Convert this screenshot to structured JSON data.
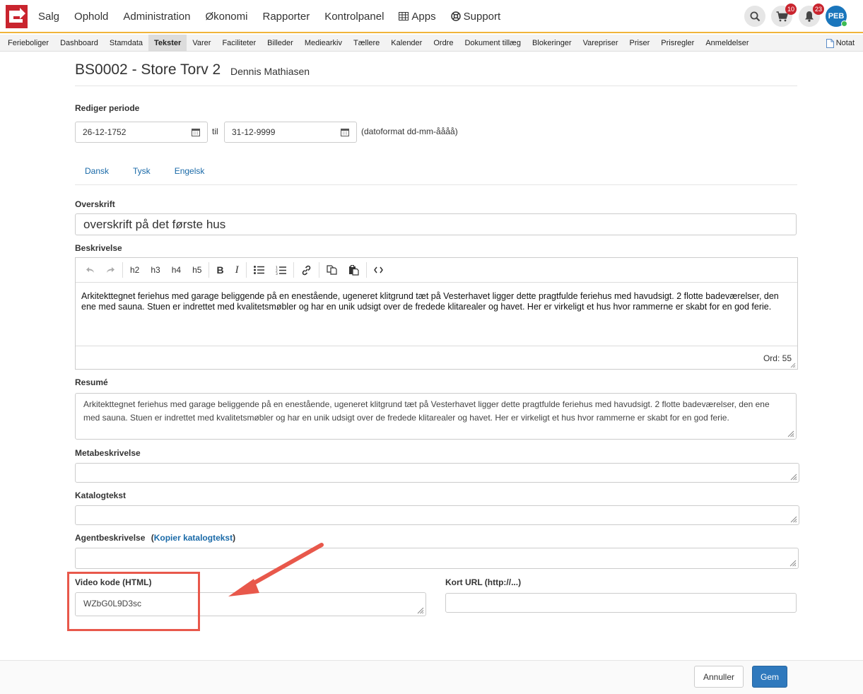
{
  "nav": {
    "items": [
      "Salg",
      "Ophold",
      "Administration",
      "Økonomi",
      "Rapporter",
      "Kontrolpanel",
      "Apps",
      "Support"
    ],
    "cart_count": "10",
    "notification_count": "23",
    "user_initials": "PEB"
  },
  "subnav": {
    "items": [
      "Ferieboliger",
      "Dashboard",
      "Stamdata",
      "Tekster",
      "Varer",
      "Faciliteter",
      "Billeder",
      "Mediearkiv",
      "Tællere",
      "Kalender",
      "Ordre",
      "Dokument tillæg",
      "Blokeringer",
      "Varepriser",
      "Priser",
      "Prisregler",
      "Anmeldelser"
    ],
    "active": "Tekster",
    "note_label": "Notat"
  },
  "header": {
    "title": "BS0002 - Store Torv 2",
    "owner": "Dennis Mathiasen"
  },
  "period": {
    "label": "Rediger periode",
    "from": "26-12-1752",
    "to_word": "til",
    "to": "31-12-9999",
    "format_hint": "(datoformat dd-mm-åååå)"
  },
  "language_tabs": [
    "Dansk",
    "Tysk",
    "Engelsk"
  ],
  "fields": {
    "headline_label": "Overskrift",
    "headline_value": "overskrift på det første hus",
    "description_label": "Beskrivelse",
    "description_text": "Arkitekttegnet feriehus med garage beliggende på en enestående, ugeneret klitgrund tæt på Vesterhavet ligger dette pragtfulde feriehus med havudsigt. 2 flotte badeværelser, den ene med sauna. Stuen er indrettet med kvalitetsmøbler og har en unik udsigt over de fredede klitarealer og havet. Her er virkeligt et hus hvor rammerne er skabt for en god ferie.",
    "word_count": "Ord: 55",
    "summary_label": "Resumé",
    "summary_text": "Arkitekttegnet feriehus med garage beliggende på en enestående, ugeneret klitgrund tæt på Vesterhavet ligger dette pragtfulde feriehus med havudsigt. 2 flotte badeværelser, den ene med  sauna. Stuen er indrettet med kvalitetsmøbler og har en unik udsigt over de fredede klitarealer og havet. Her er virkeligt et hus hvor rammerne er skabt for en god ferie.",
    "meta_label": "Metabeskrivelse",
    "catalog_label": "Katalogtekst",
    "agent_label": "Agentbeskrivelse",
    "agent_paren_open": "(",
    "agent_link": "Kopier katalogtekst",
    "agent_paren_close": ")",
    "video_label": "Video kode (HTML)",
    "video_value": "WZbG0L9D3sc",
    "short_url_label": "Kort URL (http://...)"
  },
  "toolbar": {
    "h2": "h2",
    "h3": "h3",
    "h4": "h4",
    "h5": "h5",
    "bold": "B",
    "italic": "I"
  },
  "actions": {
    "cancel": "Annuller",
    "save": "Gem"
  },
  "colors": {
    "accent": "#f0b43a",
    "primary": "#2f79bd",
    "link": "#1a6aa8",
    "badge": "#c9242e",
    "annotation": "#e8584b"
  }
}
